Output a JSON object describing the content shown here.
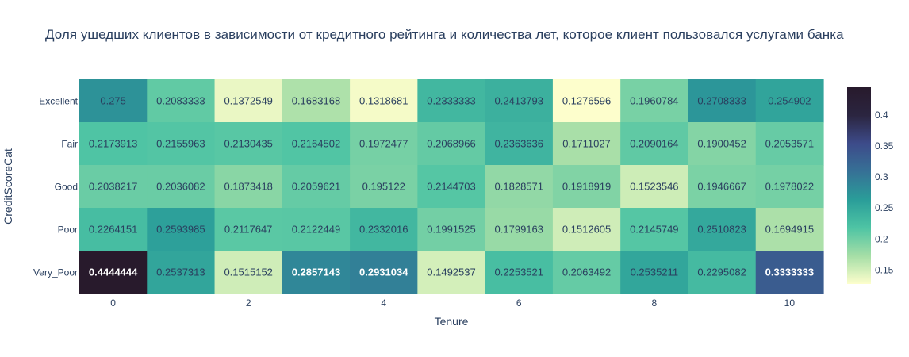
{
  "chart_data": {
    "type": "heatmap",
    "title": "Доля ушедших клиентов в зависимости от кредитного рейтинга и количества лет, которое клиент пользовался услугами банка",
    "xlabel": "Tenure",
    "ylabel": "CreditScoreCat",
    "x": [
      0,
      1,
      2,
      3,
      4,
      5,
      6,
      7,
      8,
      9,
      10
    ],
    "x_tick_labels": [
      "0",
      "2",
      "4",
      "6",
      "8",
      "10"
    ],
    "y": [
      "Excellent",
      "Fair",
      "Good",
      "Poor",
      "Very_Poor"
    ],
    "values": [
      [
        "0.275",
        "0.2083333",
        "0.1372549",
        "0.1683168",
        "0.1318681",
        "0.2333333",
        "0.2413793",
        "0.1276596",
        "0.1960784",
        "0.2708333",
        "0.254902"
      ],
      [
        "0.2173913",
        "0.2155963",
        "0.2130435",
        "0.2164502",
        "0.1972477",
        "0.2068966",
        "0.2363636",
        "0.1711027",
        "0.2090164",
        "0.1900452",
        "0.2053571"
      ],
      [
        "0.2038217",
        "0.2036082",
        "0.1873418",
        "0.2059621",
        "0.195122",
        "0.2144703",
        "0.1828571",
        "0.1918919",
        "0.1523546",
        "0.1946667",
        "0.1978022"
      ],
      [
        "0.2264151",
        "0.2593985",
        "0.2117647",
        "0.2122449",
        "0.2332016",
        "0.1991525",
        "0.1799163",
        "0.1512605",
        "0.2145749",
        "0.2510823",
        "0.1694915"
      ],
      [
        "0.4444444",
        "0.2537313",
        "0.1515152",
        "0.2857143",
        "0.2931034",
        "0.1492537",
        "0.2253521",
        "0.2063492",
        "0.2535211",
        "0.2295082",
        "0.3333333"
      ]
    ],
    "zmin": 0.1276596,
    "zmax": 0.4444444,
    "colorscale": "deep",
    "colorscale_stops": [
      "#fdfecc",
      "#a5dea6",
      "#4ec4a4",
      "#2a9d99",
      "#367196",
      "#3d4b8a",
      "#2b2540",
      "#281a2c"
    ],
    "colorbar_ticks": [
      "0.15",
      "0.2",
      "0.25",
      "0.3",
      "0.35",
      "0.4"
    ],
    "text_color_dark": "#2a3f5f",
    "text_color_light": "#ffffff",
    "grid": false,
    "legend": "colorbar-right"
  }
}
